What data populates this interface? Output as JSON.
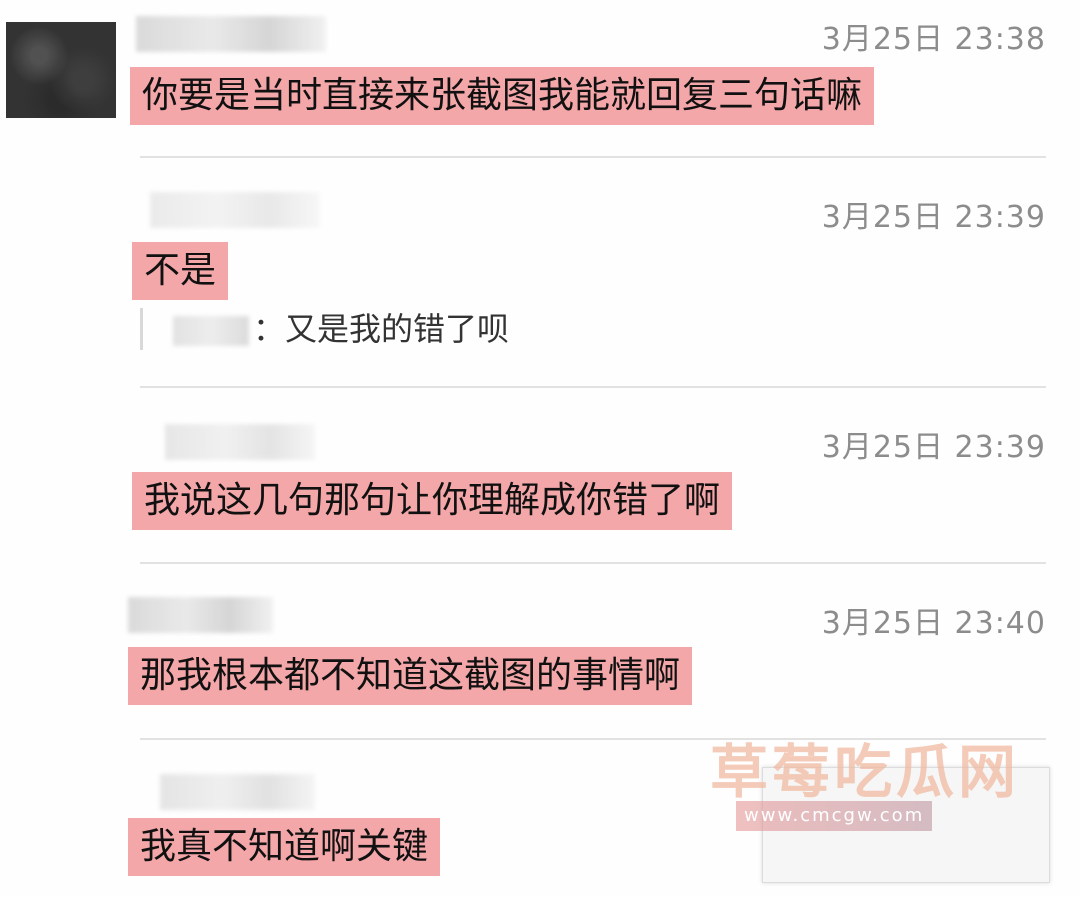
{
  "messages": [
    {
      "time": "3月25日 23:38",
      "text": "你要是当时直接来张截图我能就回复三句话嘛"
    },
    {
      "time": "3月25日 23:39",
      "text": "不是",
      "quote": {
        "separator": "：",
        "text": "又是我的错了呗"
      }
    },
    {
      "time": "3月25日 23:39",
      "text": "我说这几句那句让你理解成你错了啊"
    },
    {
      "time": "3月25日 23:40",
      "text": "那我根本都不知道这截图的事情啊"
    },
    {
      "time": "",
      "text": "我真不知道啊关键"
    }
  ],
  "watermark": {
    "title": "草莓吃瓜网",
    "url": "www.cmcgw.com"
  },
  "colors": {
    "highlight": "#f4a7a9",
    "timestamp": "#8c8c8c",
    "divider": "#e2e2e2"
  }
}
